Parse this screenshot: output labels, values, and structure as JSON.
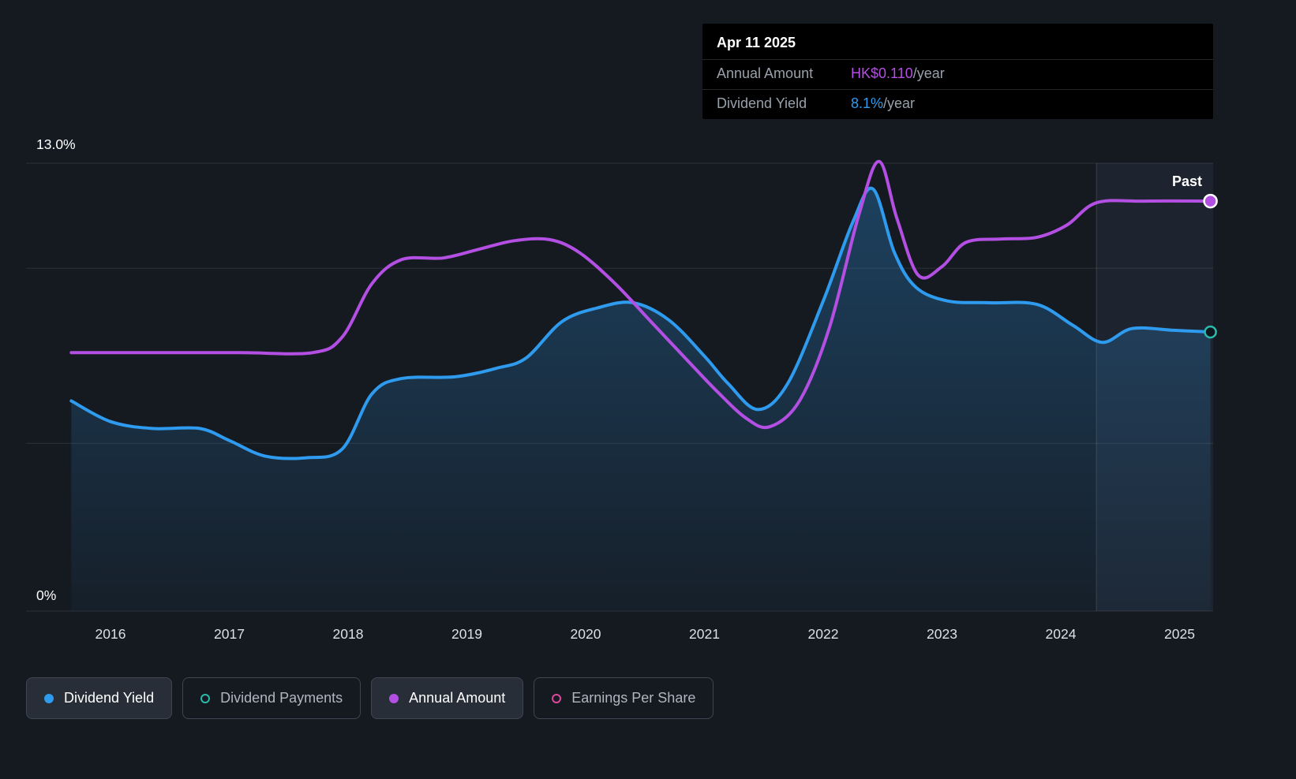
{
  "colors": {
    "blue": "#2F9BEF",
    "purple": "#B44FE3",
    "teal": "#2BBBAD",
    "pink": "#E0479E",
    "background": "#151A21"
  },
  "tooltip": {
    "date": "Apr 11 2025",
    "row1_label": "Annual Amount",
    "row1_value": "HK$0.110",
    "row1_suffix": "/year",
    "row2_label": "Dividend Yield",
    "row2_value": "8.1%",
    "row2_suffix": "/year"
  },
  "axis": {
    "y_max_label": "13.0%",
    "y_min_label": "0%",
    "past_label": "Past"
  },
  "legend": {
    "items": [
      {
        "label": "Dividend Yield",
        "marker": "filled",
        "color": "#2F9BEF",
        "active": true
      },
      {
        "label": "Dividend Payments",
        "marker": "ring",
        "color": "#2BBBAD",
        "active": false
      },
      {
        "label": "Annual Amount",
        "marker": "filled",
        "color": "#B44FE3",
        "active": true
      },
      {
        "label": "Earnings Per Share",
        "marker": "ring",
        "color": "#E0479E",
        "active": false
      }
    ]
  },
  "chart_data": {
    "type": "line",
    "x_axis": {
      "ticks": [
        2016,
        2017,
        2018,
        2019,
        2020,
        2021,
        2022,
        2023,
        2024,
        2025
      ],
      "min": 2015.67,
      "max": 2025.26
    },
    "y_axis": {
      "min": 0,
      "max": 13,
      "max_label": "13.0%",
      "min_label": "0%",
      "unit": "%"
    },
    "gridlines_pct": [
      13.0,
      9.95,
      4.87,
      0
    ],
    "past_divider_x": 2024.3,
    "legend_position": "bottom-left",
    "current": {
      "date": "Apr 11 2025",
      "annual_amount": "HK$0.110/year",
      "dividend_yield": "8.1%/year"
    },
    "series": [
      {
        "name": "Dividend Yield",
        "color_key": "blue",
        "unit": "%",
        "area": true,
        "end_marker": "ring",
        "end_marker_color": "teal",
        "points": [
          [
            2015.67,
            6.1
          ],
          [
            2016.0,
            5.5
          ],
          [
            2016.35,
            5.3
          ],
          [
            2016.75,
            5.3
          ],
          [
            2017.0,
            4.95
          ],
          [
            2017.3,
            4.5
          ],
          [
            2017.65,
            4.45
          ],
          [
            2017.95,
            4.7
          ],
          [
            2018.2,
            6.3
          ],
          [
            2018.45,
            6.75
          ],
          [
            2018.9,
            6.8
          ],
          [
            2019.25,
            7.05
          ],
          [
            2019.5,
            7.35
          ],
          [
            2019.8,
            8.4
          ],
          [
            2020.1,
            8.8
          ],
          [
            2020.4,
            8.95
          ],
          [
            2020.7,
            8.45
          ],
          [
            2021.0,
            7.4
          ],
          [
            2021.2,
            6.6
          ],
          [
            2021.45,
            5.85
          ],
          [
            2021.7,
            6.6
          ],
          [
            2022.0,
            9.0
          ],
          [
            2022.25,
            11.3
          ],
          [
            2022.42,
            12.25
          ],
          [
            2022.6,
            10.4
          ],
          [
            2022.78,
            9.4
          ],
          [
            2023.05,
            9.0
          ],
          [
            2023.4,
            8.95
          ],
          [
            2023.8,
            8.9
          ],
          [
            2024.1,
            8.3
          ],
          [
            2024.35,
            7.8
          ],
          [
            2024.6,
            8.2
          ],
          [
            2024.95,
            8.15
          ],
          [
            2025.26,
            8.1
          ]
        ]
      },
      {
        "name": "Annual Amount",
        "color_key": "purple",
        "unit": "yield-scale %",
        "area": false,
        "end_marker": "filled",
        "end_marker_color": "purple",
        "points": [
          [
            2015.67,
            7.5
          ],
          [
            2016.4,
            7.5
          ],
          [
            2017.1,
            7.5
          ],
          [
            2017.7,
            7.5
          ],
          [
            2017.95,
            7.95
          ],
          [
            2018.2,
            9.5
          ],
          [
            2018.45,
            10.2
          ],
          [
            2018.8,
            10.25
          ],
          [
            2019.1,
            10.5
          ],
          [
            2019.4,
            10.75
          ],
          [
            2019.7,
            10.78
          ],
          [
            2019.95,
            10.4
          ],
          [
            2020.25,
            9.5
          ],
          [
            2020.55,
            8.4
          ],
          [
            2020.85,
            7.3
          ],
          [
            2021.1,
            6.4
          ],
          [
            2021.35,
            5.6
          ],
          [
            2021.55,
            5.35
          ],
          [
            2021.8,
            6.1
          ],
          [
            2022.05,
            8.2
          ],
          [
            2022.3,
            11.5
          ],
          [
            2022.47,
            13.05
          ],
          [
            2022.62,
            11.4
          ],
          [
            2022.8,
            9.75
          ],
          [
            2023.0,
            10.0
          ],
          [
            2023.2,
            10.7
          ],
          [
            2023.5,
            10.8
          ],
          [
            2023.8,
            10.85
          ],
          [
            2024.05,
            11.2
          ],
          [
            2024.3,
            11.85
          ],
          [
            2024.7,
            11.9
          ],
          [
            2025.26,
            11.9
          ]
        ]
      }
    ]
  }
}
